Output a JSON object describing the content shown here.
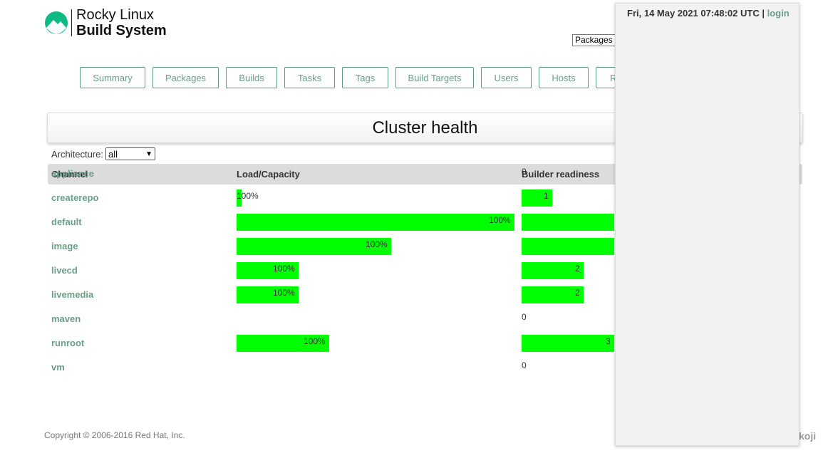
{
  "logo": {
    "line1": "Rocky Linux",
    "line2": "Build System"
  },
  "search": {
    "selected": "Packages"
  },
  "nav": [
    {
      "label": "Summary"
    },
    {
      "label": "Packages"
    },
    {
      "label": "Builds"
    },
    {
      "label": "Tasks"
    },
    {
      "label": "Tags"
    },
    {
      "label": "Build Targets"
    },
    {
      "label": "Users"
    },
    {
      "label": "Hosts"
    },
    {
      "label": "R"
    }
  ],
  "page_title": "Cluster health",
  "architecture": {
    "label": "Architecture:",
    "selected": "all"
  },
  "table": {
    "headers": {
      "channel": "Channel",
      "load": "Load/Capacity",
      "readiness": "Builder readiness"
    },
    "rows": [
      {
        "channel": "appliance",
        "load_label": "",
        "load_fraction": 0,
        "ready_label": "0",
        "ready_fraction": 0
      },
      {
        "channel": "createrepo",
        "load_label": "100%",
        "load_fraction": 0.018,
        "ready_label": "1",
        "ready_fraction": 0.33
      },
      {
        "channel": "default",
        "load_label": "100%",
        "load_fraction": 1.0,
        "ready_label": "",
        "ready_fraction": 1.0
      },
      {
        "channel": "image",
        "load_label": "100%",
        "load_fraction": 0.556,
        "ready_label": "",
        "ready_fraction": 1.0
      },
      {
        "channel": "livecd",
        "load_label": "100%",
        "load_fraction": 0.223,
        "ready_label": "2",
        "ready_fraction": 0.67
      },
      {
        "channel": "livemedia",
        "load_label": "100%",
        "load_fraction": 0.223,
        "ready_label": "2",
        "ready_fraction": 0.67
      },
      {
        "channel": "maven",
        "load_label": "",
        "load_fraction": 0,
        "ready_label": "0",
        "ready_fraction": 0
      },
      {
        "channel": "runroot",
        "load_label": "100%",
        "load_fraction": 0.333,
        "ready_label": "3",
        "ready_fraction": 1.0
      },
      {
        "channel": "vm",
        "load_label": "",
        "load_fraction": 0,
        "ready_label": "0",
        "ready_fraction": 0
      }
    ]
  },
  "footer": "Copyright © 2006-2016 Red Hat, Inc.",
  "overlay": {
    "datetime": "Fri, 14 May 2021 07:48:02 UTC",
    "separator": " | ",
    "login": "login"
  },
  "colors": {
    "accent": "#6a9e85",
    "bar": "#00ff00",
    "header_bg": "#dcdcdc"
  }
}
